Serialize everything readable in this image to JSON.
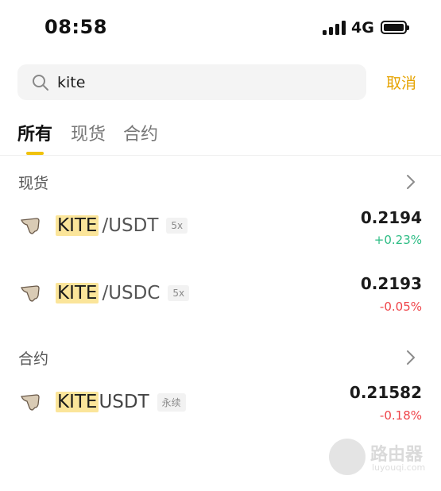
{
  "status_bar": {
    "time": "08:58",
    "network": "4G",
    "icons": [
      "cellular-signal-icon",
      "battery-icon"
    ]
  },
  "search": {
    "icon": "search-icon",
    "value": "kite",
    "placeholder": "",
    "cancel_label": "取消"
  },
  "tabs": [
    {
      "label": "所有",
      "active": true
    },
    {
      "label": "现货",
      "active": false
    },
    {
      "label": "合约",
      "active": false
    }
  ],
  "sections": {
    "spot": {
      "title": "现货",
      "rows": [
        {
          "base": "KITE",
          "quote": "/USDT",
          "tag": "5x",
          "price": "0.2194",
          "change": "+0.23%",
          "direction": "up"
        },
        {
          "base": "KITE",
          "quote": "/USDC",
          "tag": "5x",
          "price": "0.2193",
          "change": "-0.05%",
          "direction": "down"
        }
      ]
    },
    "futures": {
      "title": "合约",
      "rows": [
        {
          "base": "KITE",
          "quote": "USDT",
          "tag": "永续",
          "price": "0.21582",
          "change": "-0.18%",
          "direction": "down"
        }
      ]
    }
  },
  "watermark": {
    "name": "路由器",
    "url": "luyouqi.com"
  },
  "colors": {
    "accent": "#e6a300",
    "tab_indicator": "#f0c20c",
    "highlight": "#fbe59a",
    "up": "#2ebd85",
    "down": "#ef454a"
  }
}
